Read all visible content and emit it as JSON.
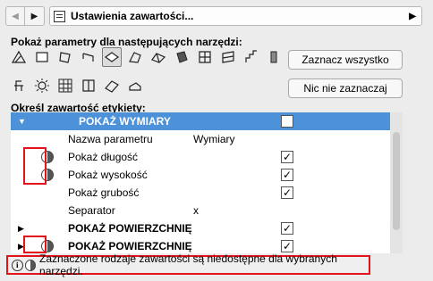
{
  "header": {
    "back_icon": "triangle-left-icon",
    "forward_icon": "triangle-right-icon",
    "title": "Ustawienia zawartości...",
    "dropdown_icon": "triangle-right-icon"
  },
  "tools_section": {
    "label": "Pokaż parametry dla następujących narzędzi:",
    "select_all": "Zaznacz wszystko",
    "select_none": "Nic nie zaznaczaj",
    "tools": [
      "fill-tool-icon",
      "slab-tool-icon",
      "beam-tool-icon",
      "railing-tool-icon",
      "roof-tool-icon",
      "shell-tool-icon",
      "mesh-tool-icon",
      "morph-tool-icon",
      "curtain-wall-tool-icon",
      "wall-panel-tool-icon",
      "stair-tool-icon",
      "column-tool-icon",
      "object-tool-icon",
      "lamp-tool-icon",
      "grid-tool-icon",
      "window-tool-icon",
      "skylight-tool-icon",
      "opening-tool-icon"
    ]
  },
  "content_section": {
    "label": "Określ zawartość etykiety:",
    "rows": [
      {
        "type": "header",
        "name": "POKAŻ WYMIARY",
        "checked": true,
        "expanded": true
      },
      {
        "type": "param",
        "name": "Nazwa parametru",
        "value": "Wymiary"
      },
      {
        "type": "item",
        "name": "Pokaż długość",
        "checked": true,
        "partial": true
      },
      {
        "type": "item",
        "name": "Pokaż wysokość",
        "checked": true,
        "partial": true
      },
      {
        "type": "item",
        "name": "Pokaż grubość",
        "checked": true
      },
      {
        "type": "param",
        "name": "Separator",
        "value": "x"
      },
      {
        "type": "group",
        "name": "POKAŻ POWIERZCHNIĘ",
        "checked": true
      },
      {
        "type": "group",
        "name": "POKAŻ POWIERZCHNIĘ",
        "checked": true,
        "partial": true
      }
    ]
  },
  "footer": {
    "info_icon": "info-icon",
    "partial_icon": "half-circle-icon",
    "message": "Zaznaczone rodzaje zawartości są niedostępne dla wybranych narzędzi."
  },
  "colors": {
    "header_row": "#4d92d8",
    "highlight": "#e2131a"
  }
}
